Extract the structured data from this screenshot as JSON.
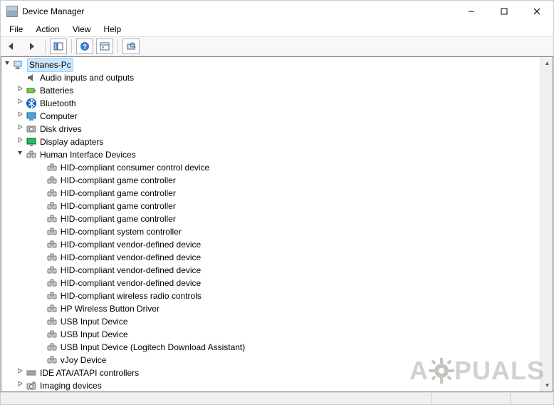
{
  "window": {
    "title": "Device Manager"
  },
  "menu": {
    "items": [
      "File",
      "Action",
      "View",
      "Help"
    ]
  },
  "toolbar": {
    "buttons": [
      "back",
      "forward",
      "show-hide-console-tree",
      "help",
      "properties",
      "scan-for-hardware-changes"
    ]
  },
  "tree": {
    "root": {
      "label": "Shanes-Pc",
      "expanded": true,
      "selected": true,
      "icon": "pc"
    },
    "categories": [
      {
        "label": "Audio inputs and outputs",
        "icon": "audio",
        "expanded": false,
        "expander": "none"
      },
      {
        "label": "Batteries",
        "icon": "battery",
        "expanded": false,
        "expander": "closed"
      },
      {
        "label": "Bluetooth",
        "icon": "bluetooth",
        "expanded": false,
        "expander": "closed"
      },
      {
        "label": "Computer",
        "icon": "computer",
        "expanded": false,
        "expander": "closed"
      },
      {
        "label": "Disk drives",
        "icon": "disk",
        "expanded": false,
        "expander": "closed"
      },
      {
        "label": "Display adapters",
        "icon": "display",
        "expanded": false,
        "expander": "closed"
      },
      {
        "label": "Human Interface Devices",
        "icon": "hid",
        "expanded": true,
        "expander": "open",
        "children": [
          {
            "label": "HID-compliant consumer control device",
            "icon": "hid"
          },
          {
            "label": "HID-compliant game controller",
            "icon": "hid"
          },
          {
            "label": "HID-compliant game controller",
            "icon": "hid"
          },
          {
            "label": "HID-compliant game controller",
            "icon": "hid"
          },
          {
            "label": "HID-compliant game controller",
            "icon": "hid"
          },
          {
            "label": "HID-compliant system controller",
            "icon": "hid"
          },
          {
            "label": "HID-compliant vendor-defined device",
            "icon": "hid"
          },
          {
            "label": "HID-compliant vendor-defined device",
            "icon": "hid"
          },
          {
            "label": "HID-compliant vendor-defined device",
            "icon": "hid"
          },
          {
            "label": "HID-compliant vendor-defined device",
            "icon": "hid"
          },
          {
            "label": "HID-compliant wireless radio controls",
            "icon": "hid"
          },
          {
            "label": "HP Wireless Button Driver",
            "icon": "hid"
          },
          {
            "label": "USB Input Device",
            "icon": "hid"
          },
          {
            "label": "USB Input Device",
            "icon": "hid"
          },
          {
            "label": "USB Input Device (Logitech Download Assistant)",
            "icon": "hid"
          },
          {
            "label": "vJoy Device",
            "icon": "hid"
          }
        ]
      },
      {
        "label": "IDE ATA/ATAPI controllers",
        "icon": "ide",
        "expanded": false,
        "expander": "closed"
      },
      {
        "label": "Imaging devices",
        "icon": "imaging",
        "expanded": false,
        "expander": "closed"
      }
    ]
  },
  "watermark": "A   PUALS"
}
